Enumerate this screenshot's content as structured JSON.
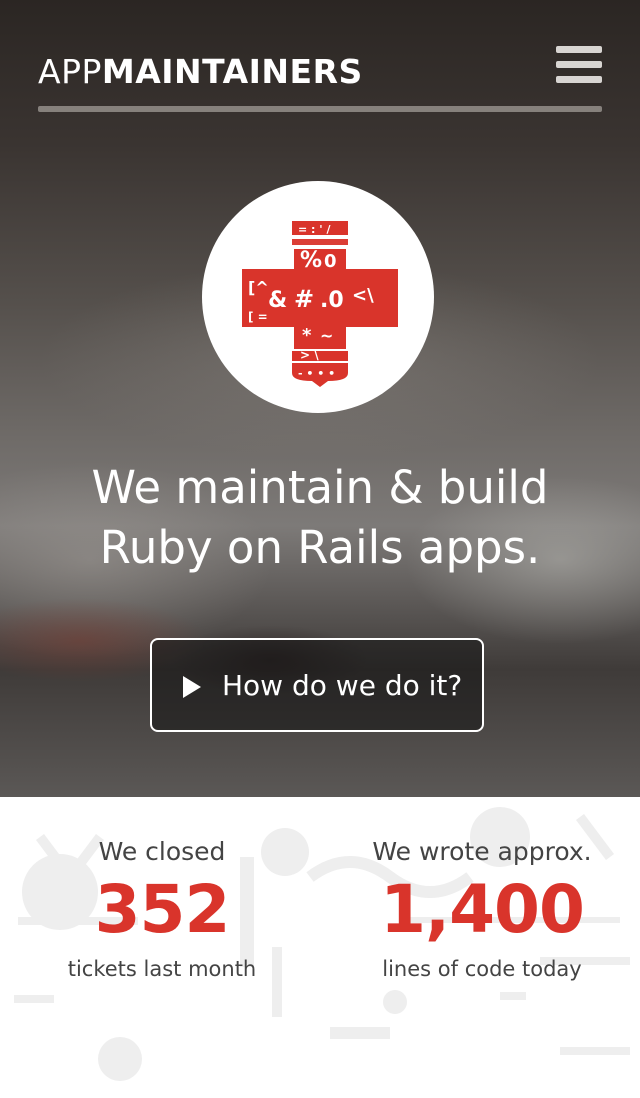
{
  "header": {
    "logo_light": "APP",
    "logo_bold": "MAINTAINERS",
    "menu_icon": "hamburger-menu-icon"
  },
  "hero": {
    "emblem_icon": "symbol-cross-logo-icon",
    "headline_line1": "We maintain & build",
    "headline_line2": "Ruby on Rails apps.",
    "cta_icon": "play-icon",
    "cta_label": "How do we do it?"
  },
  "stats": [
    {
      "prefix": "We closed",
      "value": "352",
      "suffix": "tickets last month"
    },
    {
      "prefix": "We wrote approx.",
      "value": "1,400",
      "suffix": "lines of code today"
    }
  ],
  "colors": {
    "accent": "#d9342b",
    "text_dark": "#444444",
    "white": "#ffffff"
  }
}
